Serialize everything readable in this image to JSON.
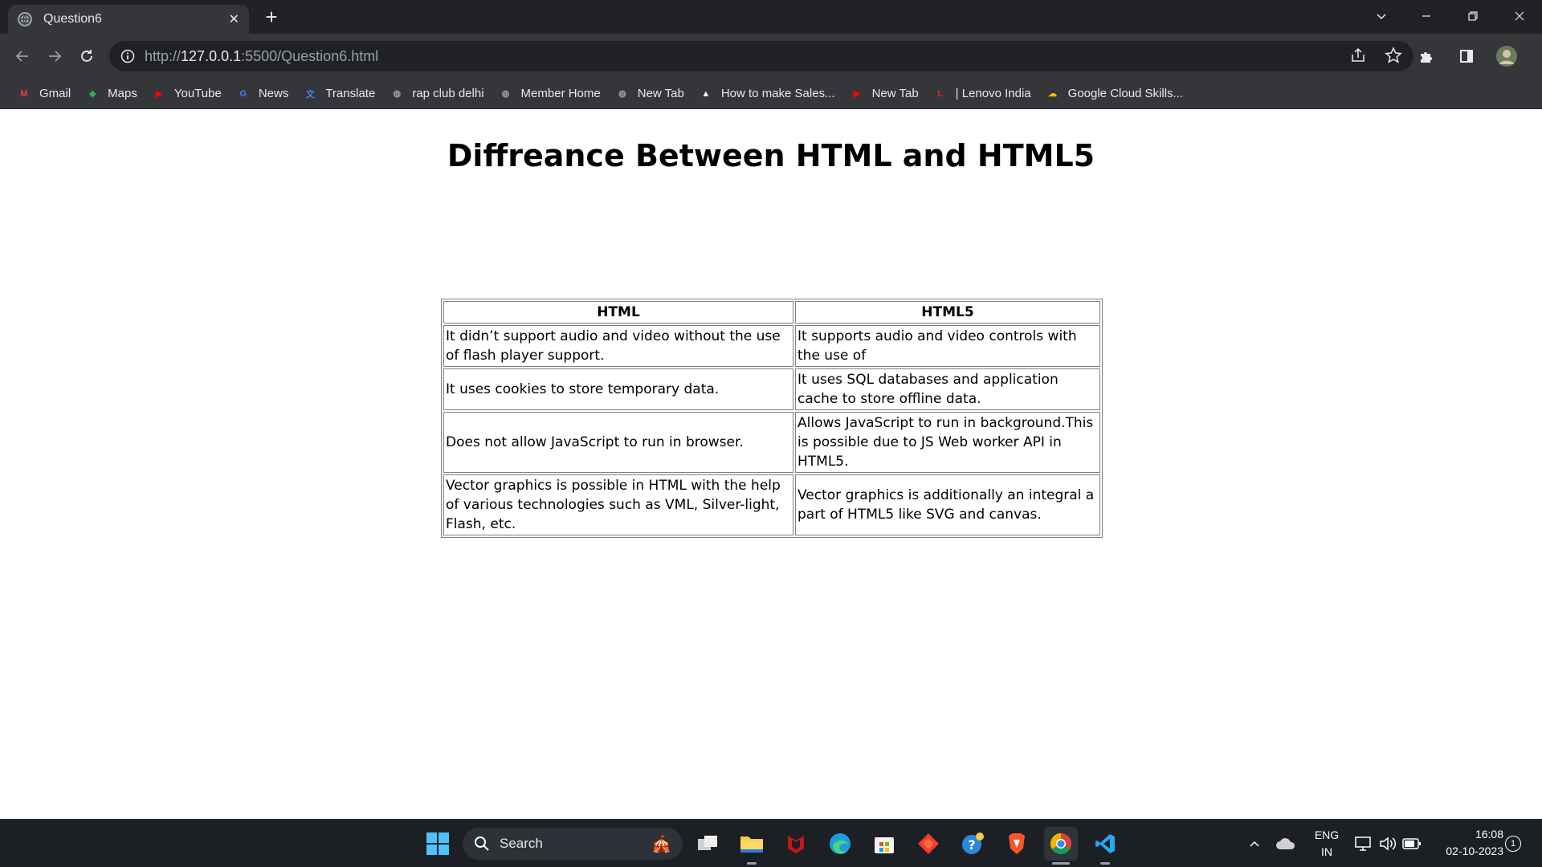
{
  "browser": {
    "tab_title": "Question6",
    "url_prefix": "http://",
    "url_host": "127.0.0.1",
    "url_path": ":5500/Question6.html"
  },
  "bookmarks": [
    {
      "label": "Gmail",
      "icon": "gmail-icon",
      "color": "#ea4335",
      "glyph": "M"
    },
    {
      "label": "Maps",
      "icon": "maps-icon",
      "color": "#34a853",
      "glyph": "◆"
    },
    {
      "label": "YouTube",
      "icon": "youtube-icon",
      "color": "#ff0000",
      "glyph": "▶"
    },
    {
      "label": "News",
      "icon": "news-icon",
      "color": "#4285f4",
      "glyph": "G"
    },
    {
      "label": "Translate",
      "icon": "translate-icon",
      "color": "#4285f4",
      "glyph": "文"
    },
    {
      "label": "rap club delhi",
      "icon": "globe-icon",
      "color": "#9aa0a6",
      "glyph": "◍"
    },
    {
      "label": "Member Home",
      "icon": "globe-icon",
      "color": "#9aa0a6",
      "glyph": "◍"
    },
    {
      "label": "New Tab",
      "icon": "globe-icon",
      "color": "#9aa0a6",
      "glyph": "◍"
    },
    {
      "label": "How to make Sales...",
      "icon": "site-icon",
      "color": "#ffffff",
      "glyph": "▲"
    },
    {
      "label": "New Tab",
      "icon": "youtube-icon",
      "color": "#ff0000",
      "glyph": "▶"
    },
    {
      "label": "| Lenovo India",
      "icon": "lenovo-icon",
      "color": "#e2231a",
      "glyph": "L"
    },
    {
      "label": "Google Cloud Skills...",
      "icon": "google-cloud-icon",
      "color": "#fbbc04",
      "glyph": "☁"
    }
  ],
  "page": {
    "heading": "Diffreance Between HTML and HTML5",
    "table": {
      "headers": [
        "HTML",
        "HTML5"
      ],
      "rows": [
        [
          "It didn’t support audio and video without the use of flash player support.",
          "It supports audio and video controls with the use of"
        ],
        [
          "It uses cookies to store temporary data.",
          "It uses SQL databases and application cache to store offline data."
        ],
        [
          "Does not allow JavaScript to run in browser.",
          "Allows JavaScript to run in background.This is possible due to JS Web worker API in HTML5."
        ],
        [
          "Vector graphics is possible in HTML with the help of various technologies such as VML, Silver-light, Flash, etc.",
          "Vector graphics is additionally an integral a part of HTML5 like SVG and canvas."
        ]
      ]
    }
  },
  "taskbar": {
    "search_placeholder": "Search",
    "lang_line1": "ENG",
    "lang_line2": "IN",
    "time": "16:08",
    "date": "02-10-2023",
    "notification_count": "1"
  }
}
